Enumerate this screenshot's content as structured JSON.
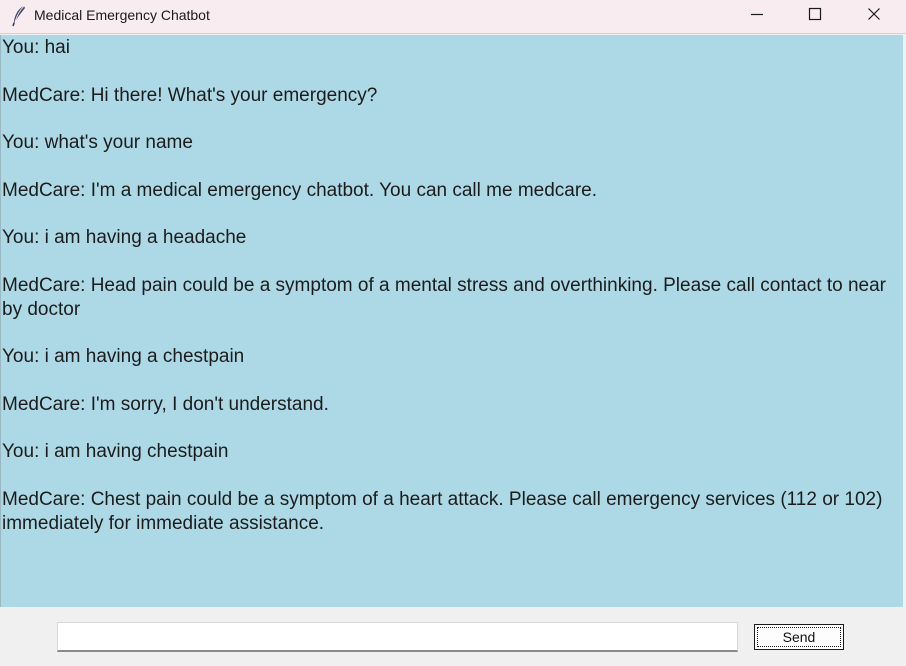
{
  "window": {
    "title": "Medical Emergency Chatbot",
    "icon": "feather-icon",
    "controls": [
      "minimize-icon",
      "maximize-icon",
      "close-icon"
    ]
  },
  "chat": {
    "background": "#add8e6",
    "messages": [
      "You: hai",
      "MedCare: Hi there! What's your emergency?",
      "You: what's your name",
      "MedCare: I'm a medical emergency chatbot. You can call me medcare.",
      "You: i am having a headache",
      "MedCare: Head pain could be a symptom of a mental stress and overthinking. Please call contact to near by doctor",
      "You: i am having a chestpain",
      "MedCare: I'm sorry, I don't understand.",
      "You: i am having chestpain",
      "MedCare: Chest pain could be a symptom of a heart attack. Please call emergency services (112 or 102) immediately for immediate assistance."
    ]
  },
  "input": {
    "value": "",
    "send_label": "Send"
  }
}
